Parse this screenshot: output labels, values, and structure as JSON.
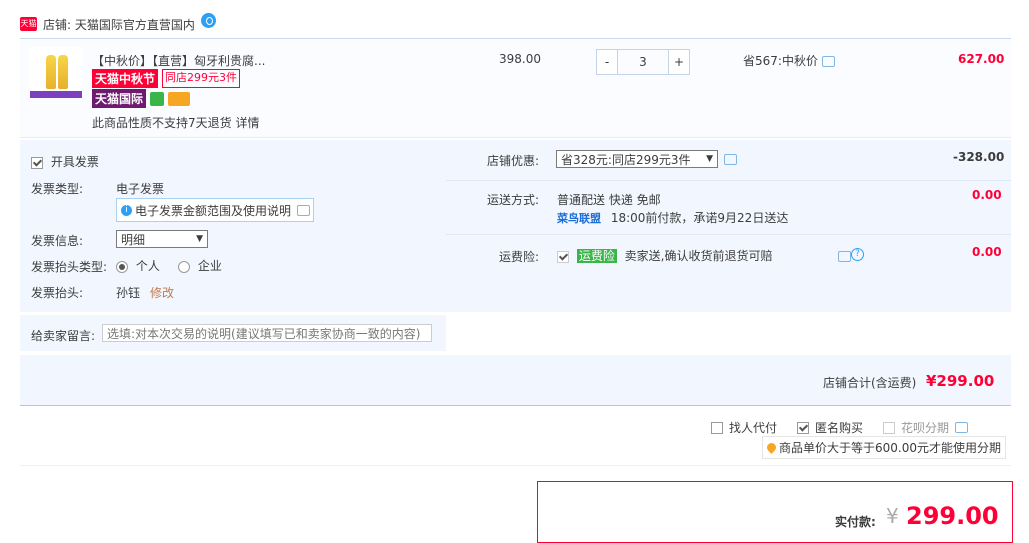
{
  "shop": {
    "badge": "天猫",
    "label": "店铺: 天猫国际官方直营国内"
  },
  "item": {
    "title": "【中秋价】【直营】匈牙利贵腐...",
    "tag_festival": "天猫中秋节",
    "tag_promo": "同店299元3件",
    "tag_intl": "天猫国际",
    "return_note": "此商品性质不支持7天退货 详情",
    "price": "398.00",
    "qty_minus": "-",
    "qty_value": "3",
    "qty_plus": "+",
    "saving": "省567:中秋价",
    "subtotal": "627.00"
  },
  "invoice": {
    "issue_label": "开具发票",
    "type_label": "发票类型:",
    "type_value": "电子发票",
    "info_link": "电子发票金额范围及使用说明",
    "content_label": "发票信息:",
    "content_value": "明细",
    "title_type_label": "发票抬头类型:",
    "title_type_personal": "个人",
    "title_type_company": "企业",
    "title_label": "发票抬头:",
    "title_value": "孙钰",
    "edit_link": "修改"
  },
  "message": {
    "label": "给卖家留言:",
    "placeholder": "选填:对本次交易的说明(建议填写已和卖家协商一致的内容)"
  },
  "discount": {
    "label": "店铺优惠:",
    "selected": "省328元:同店299元3件",
    "amount": "-328.00"
  },
  "shipping": {
    "label": "运送方式:",
    "method": "普通配送 快递 免邮",
    "partner": "菜鸟联盟",
    "promise": "18:00前付款，承诺9月22日送达",
    "amount": "0.00"
  },
  "insurance": {
    "label": "运费险:",
    "tag": "运费险",
    "desc": "卖家送,确认收货前退货可赔",
    "amount": "0.00"
  },
  "shop_total": {
    "label": "店铺合计(含运费)",
    "amount": "¥299.00"
  },
  "options": {
    "proxy": "找人代付",
    "anonymous": "匿名购买",
    "installment": "花呗分期",
    "installment_tip": "商品单价大于等于600.00元才能使用分期"
  },
  "payment": {
    "label": "实付款:",
    "yen": "¥",
    "amount": "299.00"
  },
  "colors": {
    "accent": "#ff0036",
    "panel": "#f2f7ff",
    "link": "#1c6ed6"
  }
}
